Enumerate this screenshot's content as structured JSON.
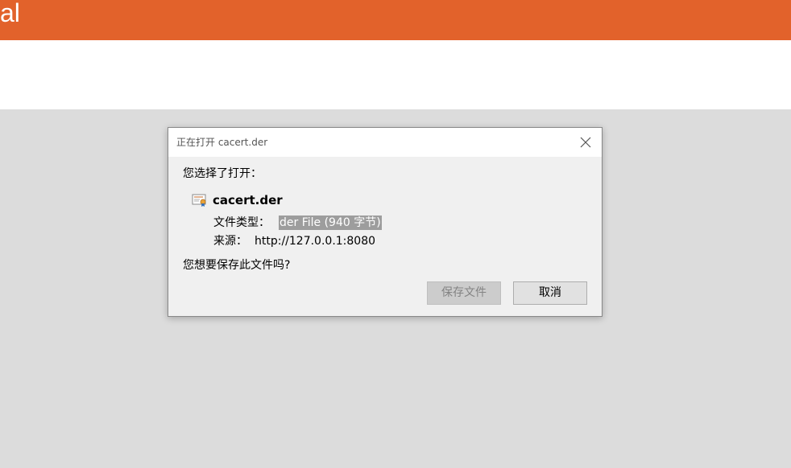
{
  "app": {
    "top_bar_text": "al",
    "accent_color": "#e2622b"
  },
  "dialog": {
    "title": "正在打开 cacert.der",
    "close_icon": "close-icon",
    "prompt": "您选择了打开：",
    "file": {
      "icon": "certificate-file-icon",
      "name": "cacert.der"
    },
    "type_label": "文件类型：",
    "type_value": "der File (940 字节)",
    "source_label": "来源：",
    "source_value": "http://127.0.0.1:8080",
    "question": "您想要保存此文件吗?",
    "buttons": {
      "save": "保存文件",
      "cancel": "取消"
    }
  }
}
